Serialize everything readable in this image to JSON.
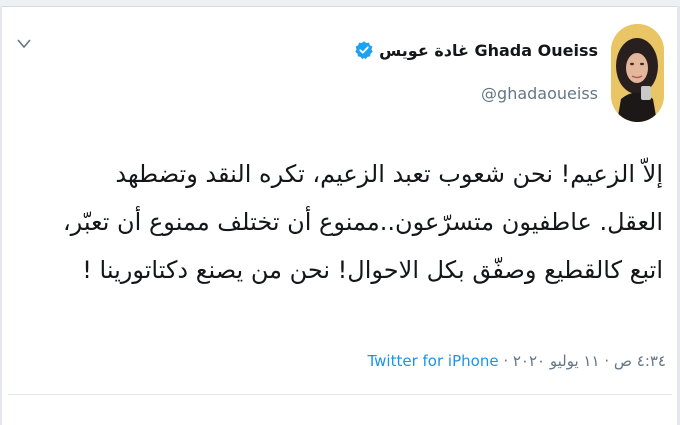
{
  "author": {
    "display_name": "غادة عويس Ghada Oueiss",
    "handle": "@ghadaoueiss"
  },
  "tweet": {
    "lines": [
      "إلاّ الزعيم! نحن شعوب تعبد الزعيم، تكره النقد وتضطهد",
      "العقل. عاطفيون متسرّعون..ممنوع أن تختلف ممنوع أن تعبّر،",
      "اتبع كالقطيع وصفّق بكل الاحوال! نحن من يصنع دكتاتورينا !"
    ]
  },
  "meta": {
    "time_date": "٤:٣٤ ص · ١١ يوليو ٢٠٢٠",
    "separator": " · ",
    "source": "Twitter for iPhone"
  },
  "icons": {
    "menu": "chevron-down-icon",
    "verified": "verified-badge-icon",
    "avatar": "profile-photo"
  },
  "colors": {
    "accent": "#1da1f2",
    "link": "#1b95e0",
    "text": "#14171a",
    "muted": "#657786"
  }
}
